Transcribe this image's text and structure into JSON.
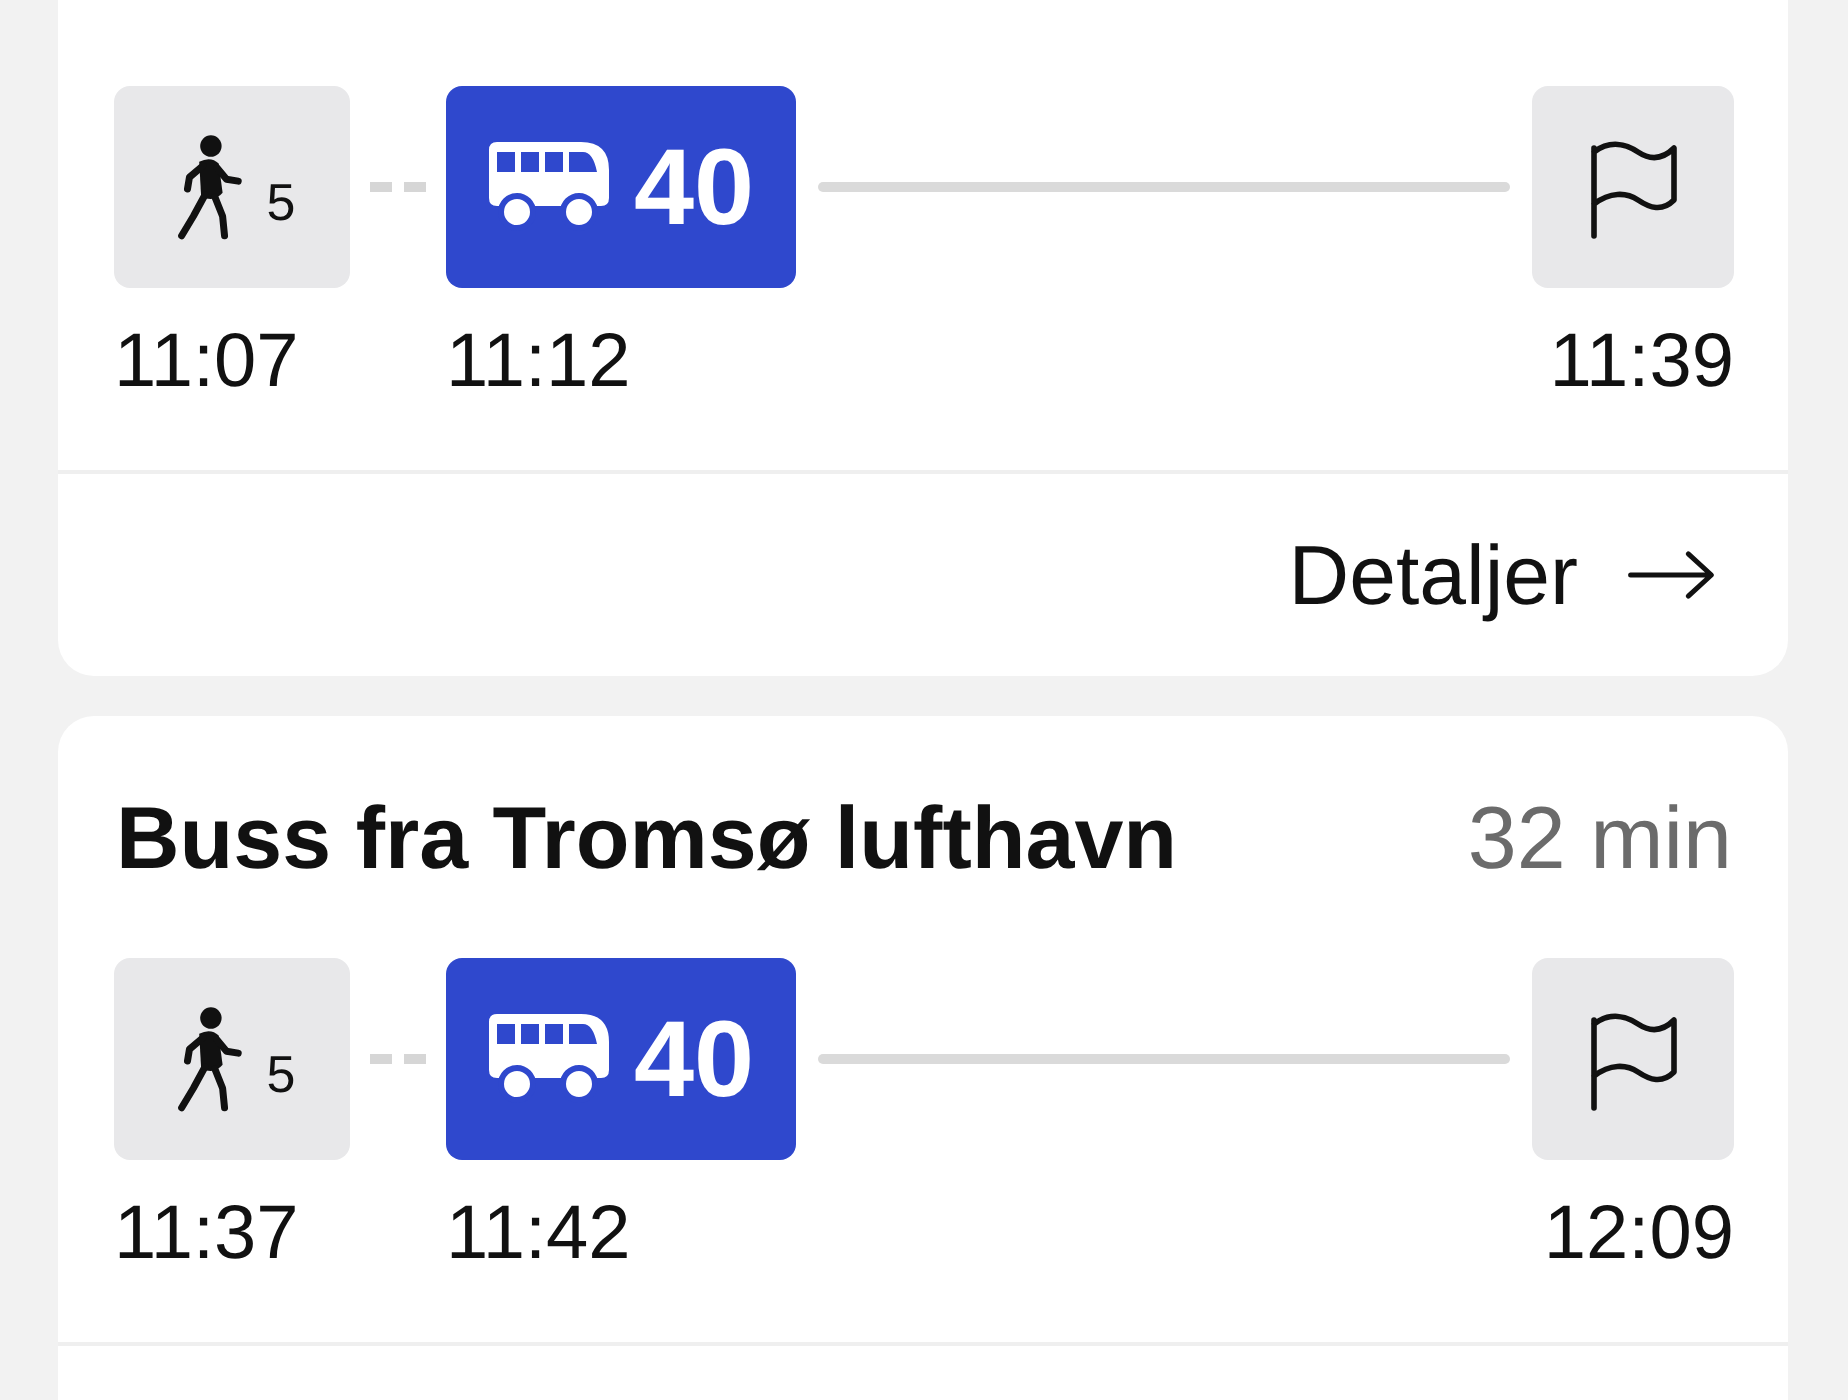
{
  "trips": [
    {
      "legs": [
        {
          "kind": "walk",
          "minutes": "5",
          "time": "11:07"
        },
        {
          "kind": "bus",
          "line": "40",
          "time": "11:12"
        },
        {
          "kind": "arrival",
          "time": "11:39"
        }
      ],
      "details_link": "Detaljer"
    },
    {
      "title": "Buss fra Tromsø lufthavn",
      "duration": "32 min",
      "legs": [
        {
          "kind": "walk",
          "minutes": "5",
          "time": "11:37"
        },
        {
          "kind": "bus",
          "line": "40",
          "time": "11:42"
        },
        {
          "kind": "arrival",
          "time": "12:09"
        }
      ]
    }
  ]
}
